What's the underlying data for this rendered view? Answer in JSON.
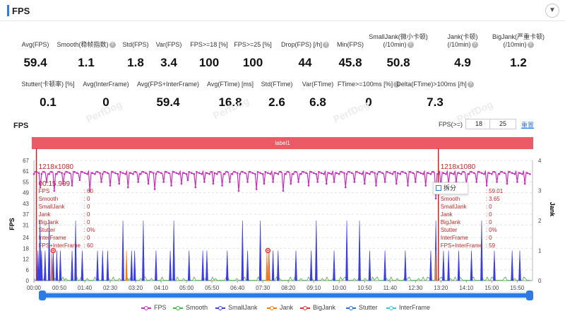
{
  "header": {
    "title": "FPS",
    "toggle_icon": "chevron-down-icon"
  },
  "stats_row1": [
    {
      "label": "Avg(FPS)",
      "value": "59.4",
      "help": false
    },
    {
      "label": "Smooth(稳帧指数)",
      "value": "1.1",
      "help": true
    },
    {
      "label": "Std(FPS)",
      "value": "1.8",
      "help": false
    },
    {
      "label": "Var(FPS)",
      "value": "3.4",
      "help": false
    },
    {
      "label": "FPS>=18 [%]",
      "value": "100",
      "help": false
    },
    {
      "label": "FPS>=25 [%]",
      "value": "100",
      "help": false
    },
    {
      "label": "Drop(FPS) [/h]",
      "value": "44",
      "help": true
    },
    {
      "label": "Min(FPS)",
      "value": "45.8",
      "help": false
    },
    {
      "label": "SmallJank(微小卡顿)",
      "label2": "(/10min)",
      "value": "50.8",
      "help": true
    },
    {
      "label": "Jank(卡顿)",
      "label2": "(/10min)",
      "value": "4.9",
      "help": true
    },
    {
      "label": "BigJank(严重卡顿)",
      "label2": "(/10min)",
      "value": "1.2",
      "help": true
    }
  ],
  "stats_row2": [
    {
      "label": "Stutter(卡顿率) [%]",
      "value": "0.1",
      "help": false
    },
    {
      "label": "Avg(InterFrame)",
      "value": "0",
      "help": false
    },
    {
      "label": "Avg(FPS+InterFrame)",
      "value": "59.4",
      "help": false
    },
    {
      "label": "Avg(FTime) [ms]",
      "value": "16.8",
      "help": false
    },
    {
      "label": "Std(FTime)",
      "value": "2.6",
      "help": false
    },
    {
      "label": "Var(FTime)",
      "value": "6.8",
      "help": false
    },
    {
      "label": "FTime>=100ms [%]",
      "value": "0",
      "help": true
    },
    {
      "label": "Delta(FTime)>100ms [/h]",
      "value": "7.3",
      "help": true
    }
  ],
  "watermark": "PerfDog",
  "chart_header": {
    "title": "FPS",
    "threshold_label": "FPS(>=)",
    "threshold_1": "18",
    "threshold_2": "25",
    "reset_label": "重置"
  },
  "label_bar": "label1",
  "tooltip_split": "拆分",
  "colors": {
    "fps": "#c62fb9",
    "smooth": "#3cb93c",
    "smalljank": "#3a3ee0",
    "jank": "#f07a1a",
    "bigjank": "#e0322d",
    "stutter": "#2b6fd6",
    "interframe": "#36c7d3",
    "marker": "#c62828",
    "label_bar": "#ec5a66",
    "accent": "#2d7be5"
  },
  "chart_data": {
    "type": "line",
    "ylabel_left": "FPS",
    "ylabel_right": "Jank",
    "y_ticks_left": [
      "0",
      "6",
      "12",
      "18",
      "24",
      "31",
      "37",
      "43",
      "49",
      "55",
      "61",
      "67"
    ],
    "ylim_left": [
      0,
      67
    ],
    "y_ticks_right": [
      "0",
      "1",
      "2",
      "3",
      "4"
    ],
    "ylim_right": [
      0,
      4
    ],
    "x_ticks": [
      "00:00",
      "00:50",
      "01:40",
      "02:30",
      "03:20",
      "04:10",
      "05:00",
      "05:50",
      "06:40",
      "07:30",
      "08:20",
      "09:10",
      "10:00",
      "10:50",
      "11:40",
      "12:30",
      "13:20",
      "14:10",
      "15:00",
      "15:50"
    ],
    "x_seconds": [
      0,
      50,
      100,
      150,
      200,
      250,
      300,
      350,
      400,
      450,
      500,
      550,
      600,
      650,
      700,
      750,
      800,
      850,
      900,
      950
    ],
    "xlim_seconds": [
      0,
      980
    ],
    "series": [
      {
        "name": "FPS",
        "baseline": 60,
        "dips": [
          [
            12,
            52
          ],
          [
            25,
            55
          ],
          [
            40,
            50
          ],
          [
            58,
            54
          ],
          [
            75,
            53
          ],
          [
            90,
            56
          ],
          [
            110,
            50
          ],
          [
            132,
            55
          ],
          [
            150,
            53
          ],
          [
            168,
            54
          ],
          [
            185,
            52
          ],
          [
            205,
            55
          ],
          [
            224,
            54
          ],
          [
            238,
            51
          ],
          [
            255,
            55
          ],
          [
            270,
            53
          ],
          [
            289,
            54
          ],
          [
            303,
            56
          ],
          [
            318,
            52
          ],
          [
            334,
            55
          ],
          [
            352,
            54
          ],
          [
            371,
            53
          ],
          [
            386,
            55
          ],
          [
            402,
            50
          ],
          [
            420,
            55
          ],
          [
            438,
            51
          ],
          [
            452,
            54
          ],
          [
            470,
            55
          ],
          [
            489,
            50
          ],
          [
            505,
            54
          ],
          [
            520,
            55
          ],
          [
            540,
            53
          ],
          [
            558,
            55
          ],
          [
            575,
            54
          ],
          [
            590,
            55
          ],
          [
            612,
            52
          ],
          [
            630,
            55
          ],
          [
            650,
            54
          ],
          [
            672,
            53
          ],
          [
            690,
            55
          ],
          [
            712,
            54
          ],
          [
            735,
            53
          ],
          [
            750,
            55
          ],
          [
            770,
            53
          ],
          [
            790,
            45.8
          ],
          [
            800,
            52
          ],
          [
            815,
            54
          ],
          [
            830,
            55
          ],
          [
            850,
            54
          ],
          [
            870,
            55
          ],
          [
            890,
            53
          ],
          [
            910,
            55
          ],
          [
            930,
            54
          ],
          [
            950,
            55
          ],
          [
            965,
            54
          ]
        ]
      },
      {
        "name": "Smooth",
        "values_note": "low values near 0-2"
      },
      {
        "name": "SmallJank",
        "spikes": [
          [
            8,
            1
          ],
          [
            12,
            2
          ],
          [
            15,
            1
          ],
          [
            22,
            1
          ],
          [
            30,
            2
          ],
          [
            38,
            1
          ],
          [
            45,
            1
          ],
          [
            52,
            1
          ],
          [
            75,
            1
          ],
          [
            82,
            2
          ],
          [
            95,
            1
          ],
          [
            125,
            1
          ],
          [
            135,
            1
          ],
          [
            145,
            1
          ],
          [
            175,
            2
          ],
          [
            192,
            1
          ],
          [
            198,
            1
          ],
          [
            215,
            2
          ],
          [
            240,
            1
          ],
          [
            268,
            1
          ],
          [
            275,
            2
          ],
          [
            305,
            1
          ],
          [
            332,
            1
          ],
          [
            340,
            1
          ],
          [
            380,
            1
          ],
          [
            410,
            2
          ],
          [
            420,
            1
          ],
          [
            445,
            2
          ],
          [
            462,
            1
          ],
          [
            470,
            1
          ],
          [
            480,
            1
          ],
          [
            515,
            1
          ],
          [
            545,
            1
          ],
          [
            555,
            2
          ],
          [
            590,
            1
          ],
          [
            615,
            2
          ],
          [
            640,
            2
          ],
          [
            660,
            1
          ],
          [
            690,
            1
          ],
          [
            730,
            1
          ],
          [
            780,
            1
          ],
          [
            790,
            2
          ],
          [
            805,
            1
          ],
          [
            815,
            1
          ],
          [
            835,
            1
          ],
          [
            860,
            1
          ],
          [
            880,
            2
          ],
          [
            905,
            1
          ],
          [
            940,
            1
          ],
          [
            955,
            1
          ]
        ]
      },
      {
        "name": "Jank",
        "spikes": [
          [
            35,
            1
          ],
          [
            182,
            1
          ],
          [
            458,
            1
          ],
          [
            462,
            1
          ],
          [
            790,
            1
          ]
        ]
      },
      {
        "name": "BigJank",
        "points": [
          [
            38,
            1
          ],
          [
            460,
            1
          ]
        ]
      },
      {
        "name": "Stutter"
      },
      {
        "name": "InterFrame"
      }
    ],
    "markers": [
      {
        "time_s": 5,
        "resolution": "1218x1080",
        "time_label": "00:15.999",
        "rows": [
          [
            "FPS",
            ": 60"
          ],
          [
            "Smooth",
            ": 0"
          ],
          [
            "SmallJank",
            ": 0"
          ],
          [
            "Jank",
            ": 0"
          ],
          [
            "BigJank",
            ": 0"
          ],
          [
            "Stutter",
            ": 0%"
          ],
          [
            "InterFrame",
            ": 0"
          ],
          [
            "FPS+InterFrame",
            ": 60"
          ]
        ]
      },
      {
        "time_s": 795,
        "resolution": "1218x1080",
        "rows": [
          [
            "FPS",
            ": 59.01"
          ],
          [
            "Smooth",
            ": 3.65"
          ],
          [
            "SmallJank",
            ": 0"
          ],
          [
            "Jank",
            ": 0"
          ],
          [
            "BigJank",
            ": 0"
          ],
          [
            "Stutter",
            ": 0%"
          ],
          [
            "InterFrame",
            ": 0"
          ],
          [
            "FPS+InterFrame",
            ": 59"
          ]
        ]
      }
    ],
    "legend": [
      "FPS",
      "Smooth",
      "SmallJank",
      "Jank",
      "BigJank",
      "Stutter",
      "InterFrame"
    ],
    "legend_position": "bottom"
  }
}
